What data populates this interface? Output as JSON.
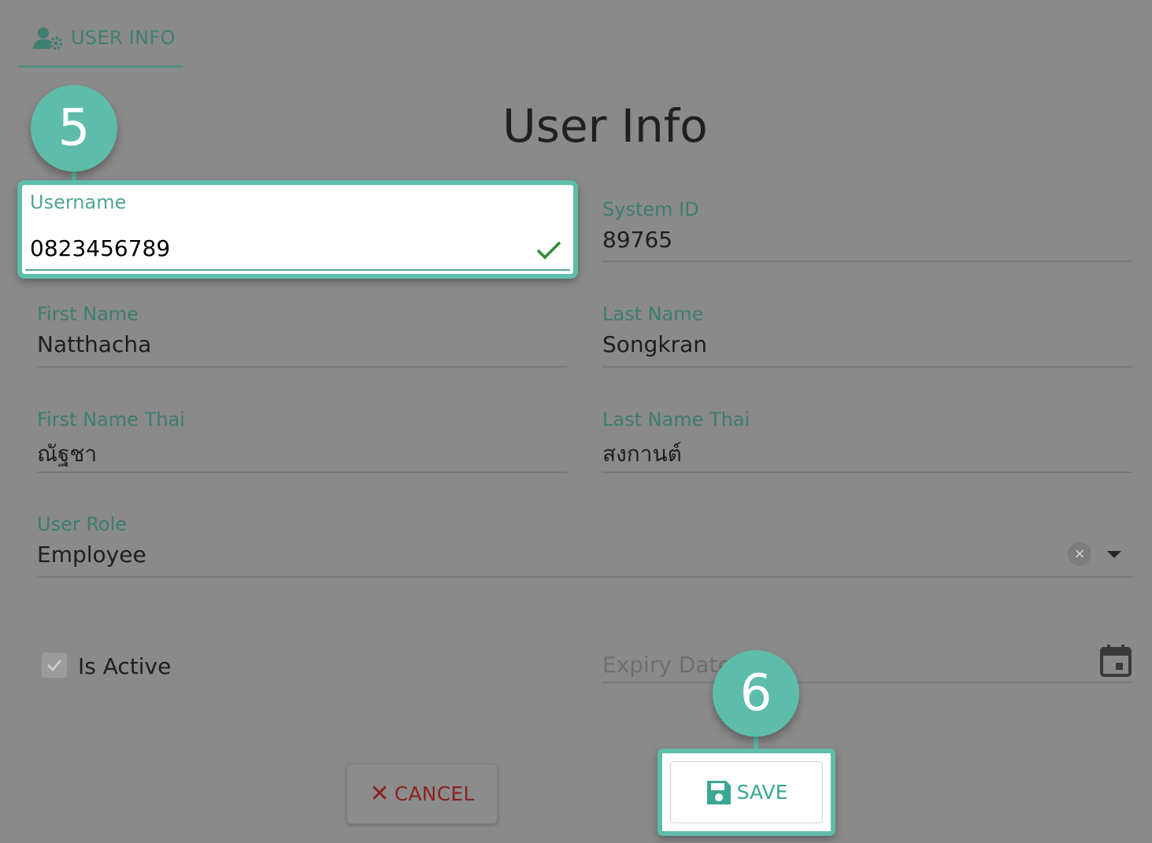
{
  "tab": {
    "label": "USER INFO",
    "icon": "user-settings-icon"
  },
  "page_title": "User Info",
  "fields": {
    "username": {
      "label": "Username",
      "value": "0823456789"
    },
    "system_id": {
      "label": "System ID",
      "value": "89765"
    },
    "first_name": {
      "label": "First Name",
      "value": "Natthacha"
    },
    "last_name": {
      "label": "Last Name",
      "value": "Songkran"
    },
    "first_name_thai": {
      "label": "First Name Thai",
      "value": "ณัฐชา"
    },
    "last_name_thai": {
      "label": "Last Name Thai",
      "value": "สงกานต์"
    },
    "user_role": {
      "label": "User Role",
      "value": "Employee"
    },
    "is_active": {
      "label": "Is Active",
      "checked": true
    },
    "expiry_date": {
      "placeholder": "Expiry Date",
      "value": ""
    }
  },
  "callouts": {
    "first": "5",
    "second": "6"
  },
  "buttons": {
    "cancel": "CANCEL",
    "save": "SAVE"
  },
  "icons": {
    "clear": "×",
    "check": "check-icon",
    "dropdown": "chevron-down-icon",
    "calendar": "calendar-icon",
    "save": "floppy-disk-icon",
    "cancel": "close-icon"
  },
  "colors": {
    "accent": "#5ebcaa",
    "label": "#3d7c70",
    "cancel": "#8a2222",
    "check": "#2e8b2e"
  }
}
